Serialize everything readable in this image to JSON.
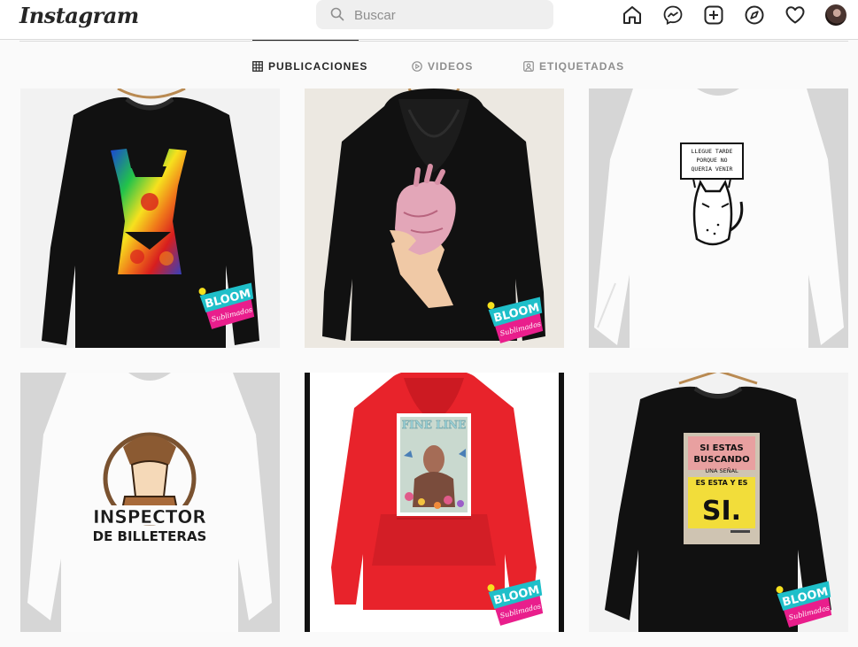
{
  "header": {
    "logo": "Instagram",
    "search_placeholder": "Buscar"
  },
  "nav_icons": [
    "home-icon",
    "messenger-icon",
    "new-post-icon",
    "explore-icon",
    "activity-icon",
    "profile-avatar"
  ],
  "tabs": [
    {
      "label": "PUBLICACIONES",
      "icon": "grid-icon",
      "active": true
    },
    {
      "label": "VIDEOS",
      "icon": "play-icon",
      "active": false
    },
    {
      "label": "ETIQUETADAS",
      "icon": "tagged-icon",
      "active": false
    }
  ],
  "posts": [
    {
      "garment": "black sweatshirt",
      "print": "rainbow body silhouette",
      "badge": "BLOOM Sublimados"
    },
    {
      "garment": "black hoodie",
      "print": "hand holding heart",
      "badge": "BLOOM Sublimados"
    },
    {
      "garment": "white sweatshirt",
      "print": "cat holding sign",
      "sign_text": "LLEGUE TARDE PORQUE NO QUERIA VENIR"
    },
    {
      "garment": "white sweatshirt",
      "print_line1": "INSPECTOR",
      "print_line2": "DE BILLETERAS"
    },
    {
      "garment": "red hoodie",
      "print": "FINE LINE",
      "badge": "BLOOM Sublimados"
    },
    {
      "garment": "black sweatshirt",
      "print_line1": "SI ESTAS",
      "print_line2": "BUSCANDO",
      "print_line3": "UNA SEÑAL",
      "print_line4": "ES ESTA Y ES",
      "print_line5": "SI.",
      "badge": "BLOOM Sublimados"
    }
  ],
  "badge": {
    "top": "BLOOM",
    "bottom": "Sublimados"
  },
  "colors": {
    "bg": "#fafafa",
    "border": "#dbdbdb",
    "badge_pink": "#e91e8c",
    "badge_teal": "#1fbfc9",
    "hoodie_red": "#e8232b"
  }
}
